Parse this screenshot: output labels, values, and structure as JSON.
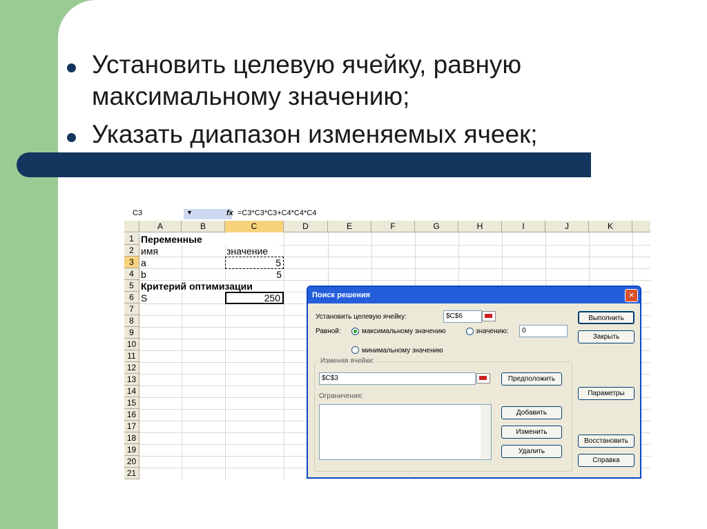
{
  "slide": {
    "bullet1": "Установить целевую ячейку, равную",
    "bullet1b": "максимальному значению;",
    "bullet2": "Указать диапазон изменяемых ячеек;",
    "colors": {
      "green": "#9bcb94",
      "navy": "#12365e"
    }
  },
  "sheet": {
    "name_box": "C3",
    "fx": "fx",
    "formula": "=C3*C3*C3+C4*C4*C4",
    "columns": [
      "A",
      "B",
      "C",
      "D",
      "E",
      "F",
      "G",
      "H",
      "I",
      "J",
      "K"
    ],
    "rows": [
      "1",
      "2",
      "3",
      "4",
      "5",
      "6",
      "7",
      "8",
      "9",
      "10",
      "11",
      "12",
      "13",
      "14",
      "15",
      "16",
      "17",
      "18",
      "19",
      "20",
      "21"
    ],
    "cells": {
      "a1": "Переменные",
      "a2": "имя",
      "c2": "значение",
      "a3": "a",
      "c3": "5",
      "a4": "b",
      "c4": "5",
      "a5": "Критерий оптимизации",
      "a6": "S",
      "c6": "250"
    }
  },
  "dialog": {
    "title": "Поиск решения",
    "close": "×",
    "target_label": "Установить целевую ячейку:",
    "target_value": "$C$6",
    "equal_label": "Равной:",
    "opt_max": "максимальному значению",
    "opt_value": "значению:",
    "value_input": "0",
    "opt_min": "минимальному значению",
    "changing_label": "Изменяя ячейки:",
    "changing_value": "$C$3",
    "guess_btn": "Предположить",
    "constraints_label": "Ограничения:",
    "add_btn": "Добавить",
    "change_btn": "Изменить",
    "delete_btn": "Удалить",
    "solve_btn": "Выполнить",
    "close_btn": "Закрыть",
    "options_btn": "Параметры",
    "reset_btn": "Восстановить",
    "help_btn": "Справка"
  }
}
